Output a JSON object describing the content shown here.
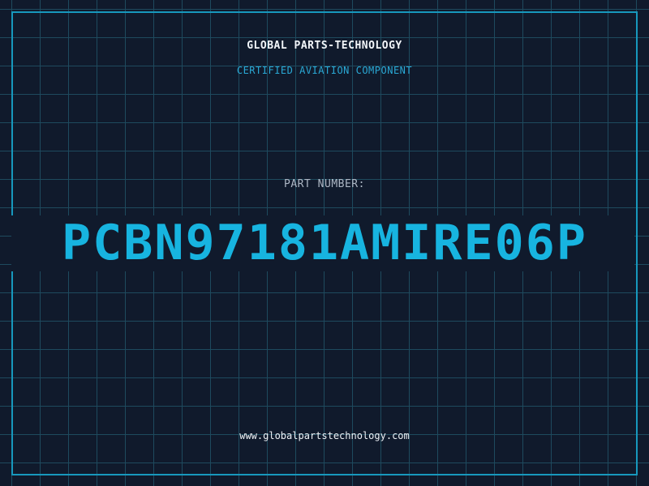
{
  "label": {
    "company": "GLOBAL PARTS-TECHNOLOGY",
    "subtitle": "CERTIFIED AVIATION COMPONENT",
    "part_number_label": "PART NUMBER:",
    "part_number": "PCBN97181AMIRE06P",
    "website": "www.globalpartstechnology.com"
  },
  "colors": {
    "background": "#101a2c",
    "grid": "#1e4a5e",
    "frame": "#1798bd",
    "accent": "#17b4e0"
  }
}
